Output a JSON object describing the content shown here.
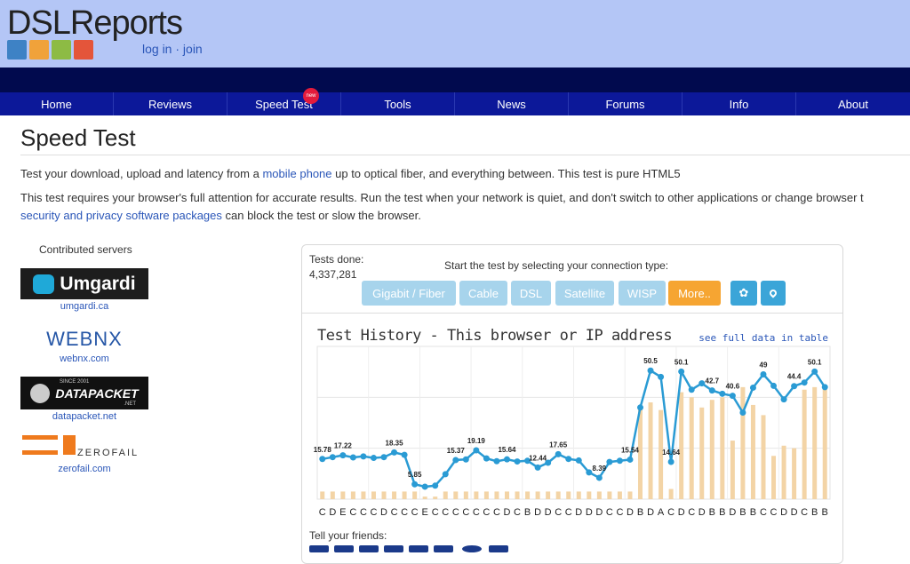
{
  "header": {
    "logo": "DSLReports",
    "login": "log in",
    "sep": "·",
    "join": "join"
  },
  "nav": [
    {
      "label": "Home"
    },
    {
      "label": "Reviews"
    },
    {
      "label": "Speed Test",
      "badge": "new"
    },
    {
      "label": "Tools"
    },
    {
      "label": "News"
    },
    {
      "label": "Forums"
    },
    {
      "label": "Info"
    },
    {
      "label": "About"
    }
  ],
  "page": {
    "title": "Speed Test",
    "intro_pre": "Test your download, upload and latency from a ",
    "intro_link": "mobile phone",
    "intro_post": " up to optical fiber, and everything between. This test is pure HTML5",
    "req_line1": "This test requires your browser's full attention for accurate results. Run the test when your network is quiet, and don't switch to other applications or change browser t",
    "req_link": "security and privacy software packages",
    "req_line2": " can block the test or slow the browser."
  },
  "servers": {
    "title": "Contributed servers",
    "items": [
      {
        "name": "Umgardi",
        "url": "umgardi.ca"
      },
      {
        "name": "WEBNX",
        "url": "webnx.com"
      },
      {
        "name": "DATAPACKET",
        "sub": "SINCE 2001",
        "sub2": ".NET",
        "url": "datapacket.net"
      },
      {
        "name": "ZEROFAIL",
        "url": "zerofail.com"
      }
    ]
  },
  "panel": {
    "tests_label": "Tests done:",
    "tests_count": "4,337,281",
    "start_text": "Start the test by selecting your connection type:",
    "buttons": [
      "Gigabit / Fiber",
      "Cable",
      "DSL",
      "Satellite",
      "WISP",
      "More.."
    ],
    "history_title": "Test History - This browser or IP address",
    "history_link": "see full data in table",
    "friends": "Tell your friends:"
  },
  "colors": {
    "header_bg": "#b4c6f6",
    "nav_bg": "#0c1899",
    "line": "#2a9bd4",
    "bar": "#f3d4a6",
    "more": "#f6a532"
  },
  "chart_data": {
    "type": "line",
    "grades": [
      "C",
      "D",
      "E",
      "C",
      "C",
      "C",
      "D",
      "C",
      "C",
      "C",
      "E",
      "C",
      "C",
      "C",
      "C",
      "C",
      "C",
      "C",
      "D",
      "C",
      "B",
      "D",
      "D",
      "C",
      "C",
      "D",
      "D",
      "D",
      "C",
      "C",
      "D",
      "B",
      "D",
      "A",
      "C",
      "D",
      "C",
      "D",
      "B",
      "B",
      "D",
      "B",
      "B",
      "C",
      "C",
      "D",
      "D",
      "C",
      "B",
      "B"
    ],
    "line_values": [
      15.78,
      16.5,
      17.22,
      16.4,
      16.8,
      16.2,
      16.5,
      18.35,
      17.4,
      5.85,
      4.9,
      5.3,
      9.8,
      15.37,
      15.6,
      19.19,
      16.0,
      14.9,
      15.64,
      14.8,
      15.1,
      12.44,
      14.3,
      17.65,
      15.8,
      15.2,
      10.5,
      8.39,
      14.6,
      15.1,
      15.54,
      36.0,
      50.5,
      48.0,
      14.64,
      50.1,
      43.0,
      45.5,
      42.7,
      41.4,
      40.6,
      34.0,
      43.8,
      49.0,
      44.5,
      39.2,
      44.4,
      45.8,
      50.1,
      44.0
    ],
    "bar_values": [
      3,
      3,
      3,
      3,
      3,
      3,
      3,
      3,
      3,
      3,
      1,
      1,
      3,
      3,
      3,
      3,
      3,
      3,
      3,
      3,
      3,
      3,
      3,
      3,
      3,
      3,
      3,
      3,
      3,
      3,
      3,
      36,
      38,
      35,
      4,
      42,
      40,
      36,
      39,
      40,
      23,
      44,
      37,
      33,
      17,
      21,
      20,
      43,
      44,
      44
    ],
    "labels": [
      {
        "i": 0,
        "text": "15.78"
      },
      {
        "i": 2,
        "text": "17.22"
      },
      {
        "i": 7,
        "text": "18.35"
      },
      {
        "i": 9,
        "text": "5.85"
      },
      {
        "i": 13,
        "text": "15.37"
      },
      {
        "i": 15,
        "text": "19.19"
      },
      {
        "i": 18,
        "text": "15.64"
      },
      {
        "i": 21,
        "text": "12.44"
      },
      {
        "i": 23,
        "text": "17.65"
      },
      {
        "i": 27,
        "text": "8.39"
      },
      {
        "i": 30,
        "text": "15.54"
      },
      {
        "i": 32,
        "text": "50.5"
      },
      {
        "i": 34,
        "text": "14.64"
      },
      {
        "i": 35,
        "text": "50.1"
      },
      {
        "i": 38,
        "text": "42.7"
      },
      {
        "i": 40,
        "text": "40.6"
      },
      {
        "i": 43,
        "text": "49"
      },
      {
        "i": 46,
        "text": "44.4"
      },
      {
        "i": 48,
        "text": "50.1"
      }
    ],
    "ylim": [
      0,
      60
    ],
    "grid": true
  }
}
